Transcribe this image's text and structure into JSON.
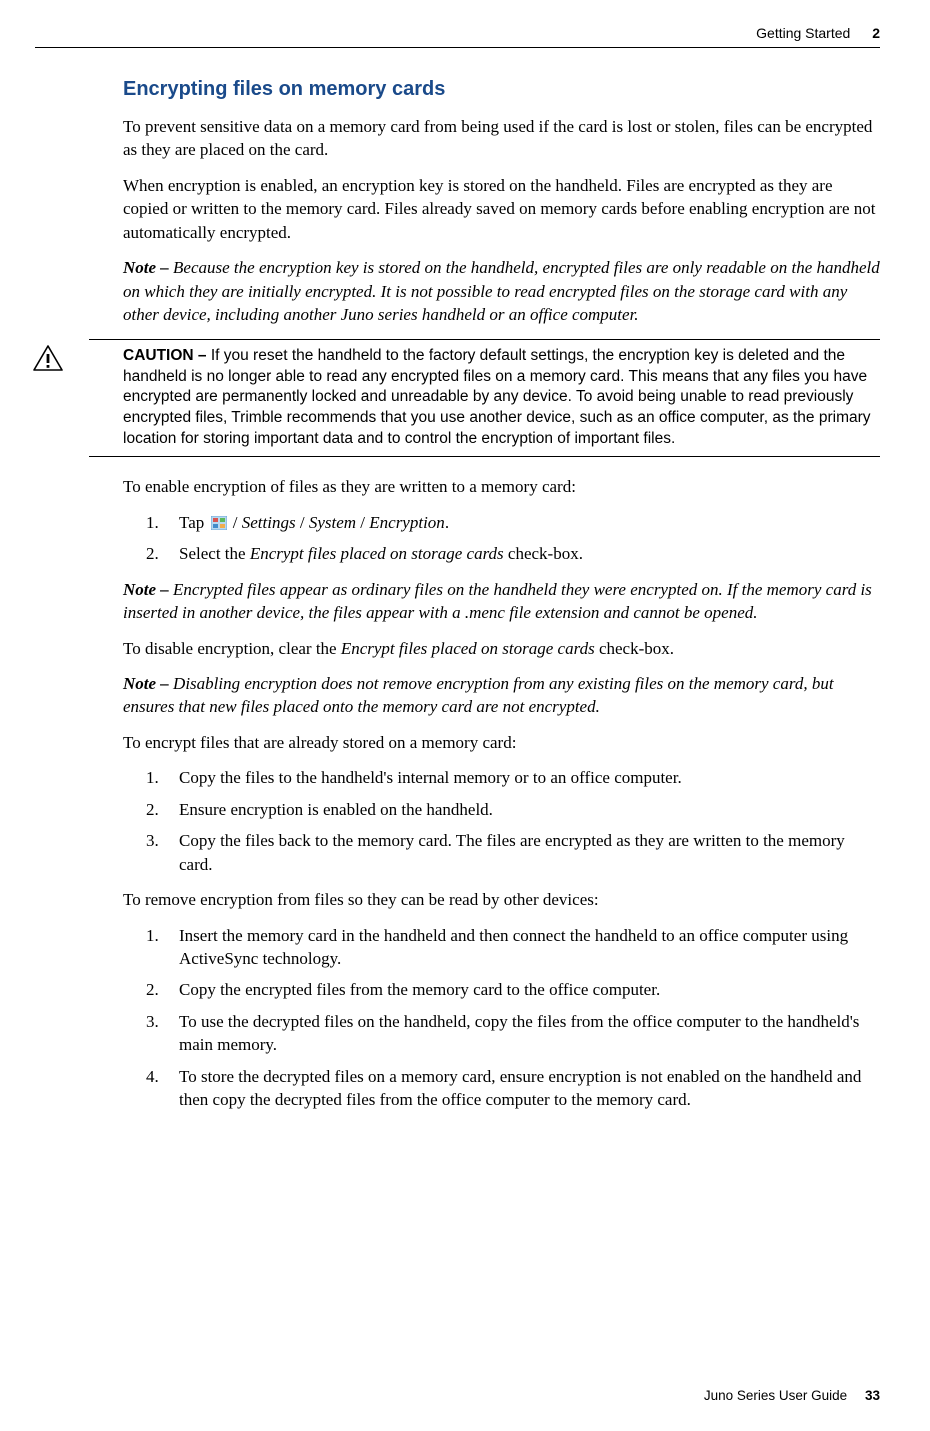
{
  "header": {
    "section": "Getting Started",
    "chapter_number": "2"
  },
  "heading": "Encrypting files on memory cards",
  "p1": "To prevent sensitive data on a  memory card from being used if the card is lost or stolen, files can be encrypted as they are placed on the card.",
  "p2": "When encryption is enabled, an encryption key is stored on the handheld. Files are encrypted as they are copied or written to the memory card. Files already saved on memory cards before enabling encryption are not automatically encrypted.",
  "note1_label": "Note – ",
  "note1": "Because the encryption key is stored on the handheld, encrypted files are only readable on the handheld on which they are initially encrypted. It is not possible to read encrypted files on the storage card with any other device, including another Juno series handheld or an office computer.",
  "caution_label": "CAUTION – ",
  "caution": "If you reset the handheld to the factory default settings, the encryption key is deleted and the handheld is no longer able to read any encrypted files on a memory card. This means that any files you have encrypted are permanently locked and unreadable by any device. To avoid being unable to read previously encrypted files, Trimble recommends that you use another device, such as an office computer, as the primary location for storing important data and to control the encryption of important files.",
  "p3": "To enable encryption of files as they are written to a memory card:",
  "listA": {
    "i1a": "Tap ",
    "i1b": " / ",
    "i1c": "Settings",
    "i1d": " / ",
    "i1e": "System",
    "i1f": " / ",
    "i1g": "Encryption",
    "i1h": ".",
    "i2a": "Select the ",
    "i2b": "Encrypt files placed on storage cards",
    "i2c": " check-box."
  },
  "note2_label": "Note – ",
  "note2": "Encrypted files appear as ordinary files on the handheld they were encrypted on.  If the memory card is inserted in another device, the files appear with a .menc file extension and cannot be opened.",
  "p4a": "To disable encryption, clear the ",
  "p4b": "Encrypt files placed on storage cards",
  "p4c": " check-box.",
  "note3_label": "Note – ",
  "note3": "Disabling encryption does not remove encryption from any existing files on the memory card, but ensures that new files placed onto the memory card are not encrypted.",
  "p5": "To encrypt files that are already stored on a memory card:",
  "listB": {
    "i1": "Copy the files to the handheld's internal memory or to an office computer.",
    "i2": "Ensure encryption is enabled on the handheld.",
    "i3": "Copy the files back to the memory card. The files are encrypted as they are written to the memory card."
  },
  "p6": "To remove encryption from files so they can be read by other devices:",
  "listC": {
    "i1": "Insert the memory card in the handheld and then connect the handheld to an office computer using ActiveSync technology.",
    "i2": "Copy the encrypted files from the memory card to the office computer.",
    "i3": "To use the decrypted files on the handheld, copy the files from the office computer to the handheld's main memory.",
    "i4": "To store the decrypted files on a memory card, ensure encryption is not enabled on the handheld and then copy the decrypted files from the office computer to the memory card."
  },
  "footer": {
    "doc": "Juno Series User Guide",
    "page": "33"
  }
}
